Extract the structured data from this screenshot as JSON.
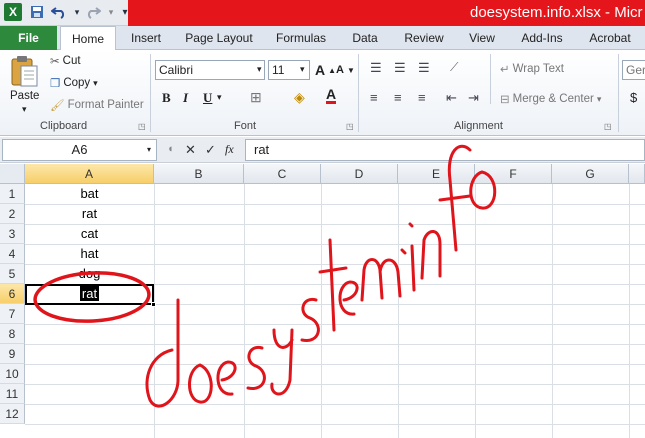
{
  "window": {
    "title": "doesystem.info.xlsx - Micr"
  },
  "quick_access": {
    "app_icon": "X",
    "save_icon": "save-icon",
    "undo_icon": "undo-icon",
    "redo_icon": "redo-icon",
    "customize_icon": "customize-icon"
  },
  "ribbon_tabs": [
    "File",
    "Home",
    "Insert",
    "Page Layout",
    "Formulas",
    "Data",
    "Review",
    "View",
    "Add-Ins",
    "Acrobat"
  ],
  "clipboard": {
    "paste": "Paste",
    "cut": "Cut",
    "copy": "Copy",
    "format_painter": "Format Painter",
    "label": "Clipboard"
  },
  "font": {
    "name": "Calibri",
    "size": "11",
    "label": "Font"
  },
  "alignment": {
    "wrap_text": "Wrap Text",
    "merge_center": "Merge & Center",
    "label": "Alignment"
  },
  "number": {
    "format": "Ger",
    "currency": "$"
  },
  "formula_bar": {
    "name_box": "A6",
    "cancel": "✕",
    "enter": "✓",
    "fx": "fx",
    "content": "rat"
  },
  "sheet": {
    "columns": [
      "A",
      "B",
      "C",
      "D",
      "E",
      "F",
      "G"
    ],
    "rows": [
      "1",
      "2",
      "3",
      "4",
      "5",
      "6",
      "7",
      "8",
      "9",
      "10",
      "11",
      "12"
    ],
    "column_a": [
      "bat",
      "rat",
      "cat",
      "hat",
      "dog",
      "rat"
    ],
    "active_cell": "A6"
  },
  "annotation": {
    "watermark_text": "doesystem.info",
    "color": "#e0141b"
  }
}
